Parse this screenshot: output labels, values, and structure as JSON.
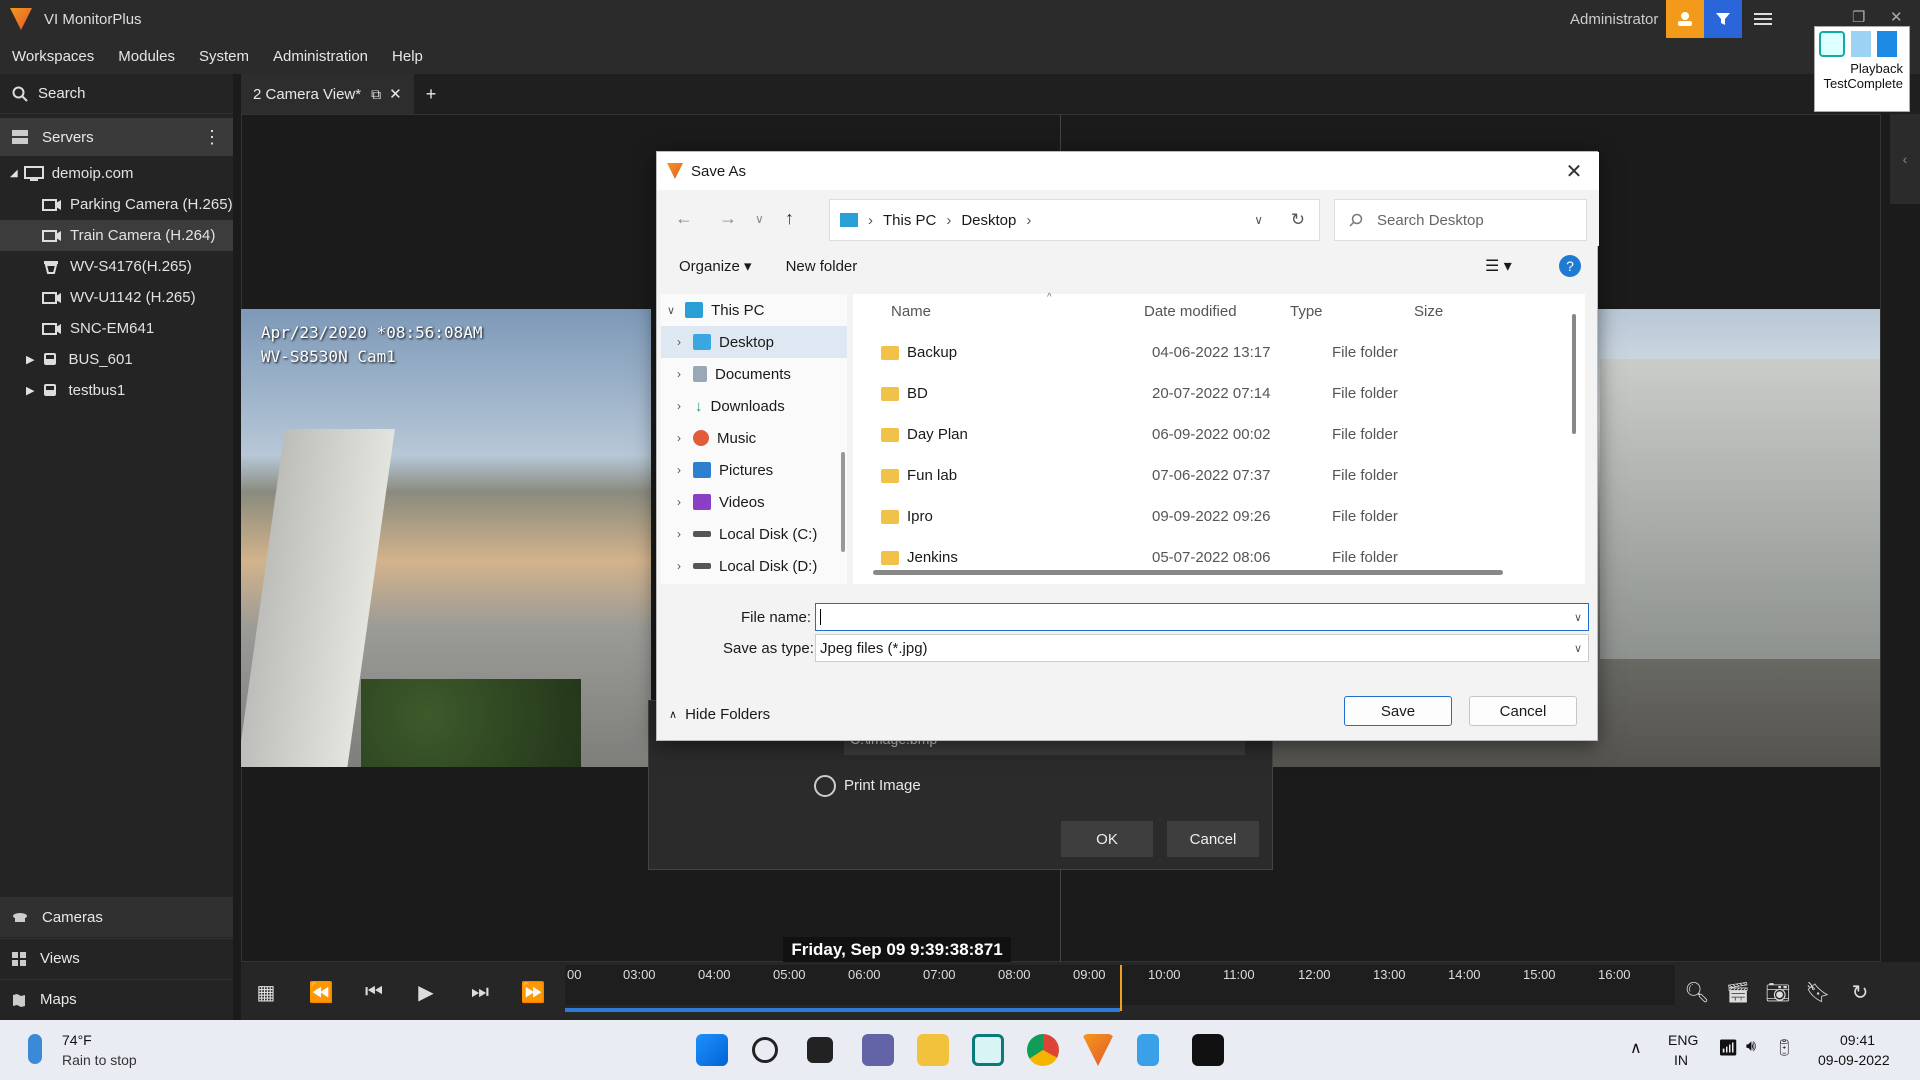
{
  "titlebar": {
    "app_title": "VI MonitorPlus",
    "user": "Administrator"
  },
  "menu": [
    "Workspaces",
    "Modules",
    "System",
    "Administration",
    "Help"
  ],
  "left": {
    "search": "Search",
    "servers": "Servers",
    "server_name": "demoip.com",
    "cameras": [
      "Parking Camera (H.265)",
      "Train Camera (H.264)",
      "WV-S4176(H.265)",
      "WV-U1142 (H.265)",
      "SNC-EM641"
    ],
    "groups": [
      "BUS_601",
      "testbus1"
    ],
    "bottom": [
      "Cameras",
      "Views",
      "Maps"
    ]
  },
  "tab": {
    "label": "2 Camera View*",
    "add": "+"
  },
  "camera_left": {
    "line1": "Apr/23/2020 *08:56:08AM",
    "line2": "WV-S8530N Cam1"
  },
  "under_dialog": {
    "path": "C:\\image.bmp",
    "browse": "...",
    "print_label": "Print Image",
    "ok": "OK",
    "cancel": "Cancel"
  },
  "saveas": {
    "title": "Save As",
    "close": "✕",
    "breadcrumb": [
      "This PC",
      "Desktop"
    ],
    "search_placeholder": "Search Desktop",
    "organize": "Organize ▾",
    "new_folder": "New folder",
    "help": "?",
    "nav": [
      "This PC",
      "Desktop",
      "Documents",
      "Downloads",
      "Music",
      "Pictures",
      "Videos",
      "Local Disk (C:)",
      "Local Disk (D:)"
    ],
    "columns": [
      "Name",
      "Date modified",
      "Type",
      "Size"
    ],
    "files": [
      {
        "name": "Backup",
        "date": "04-06-2022 13:17",
        "type": "File folder"
      },
      {
        "name": "BD",
        "date": "20-07-2022 07:14",
        "type": "File folder"
      },
      {
        "name": "Day Plan",
        "date": "06-09-2022 00:02",
        "type": "File folder"
      },
      {
        "name": "Fun lab",
        "date": "07-06-2022 07:37",
        "type": "File folder"
      },
      {
        "name": "Ipro",
        "date": "09-09-2022 09:26",
        "type": "File folder"
      },
      {
        "name": "Jenkins",
        "date": "05-07-2022 08:06",
        "type": "File folder"
      }
    ],
    "filename_label": "File name:",
    "filename_value": "",
    "type_label": "Save as type:",
    "type_value": "Jpeg files (*.jpg)",
    "hide_folders": "Hide Folders",
    "save": "Save",
    "cancel": "Cancel"
  },
  "timeline": {
    "timestamp": "Friday, Sep 09  9:39:38:871",
    "ticks": [
      "00",
      "03:00",
      "04:00",
      "05:00",
      "06:00",
      "07:00",
      "08:00",
      "09:00",
      "10:00",
      "11:00",
      "12:00",
      "13:00",
      "14:00",
      "15:00",
      "16:00"
    ],
    "progress_fraction": 0.5
  },
  "playback": {
    "label1": "Playback",
    "label2": "TestComplete"
  },
  "taskbar": {
    "temp": "74°F",
    "weather": "Rain to stop",
    "lang1": "ENG",
    "lang2": "IN",
    "time": "09:41",
    "date": "09-09-2022"
  }
}
